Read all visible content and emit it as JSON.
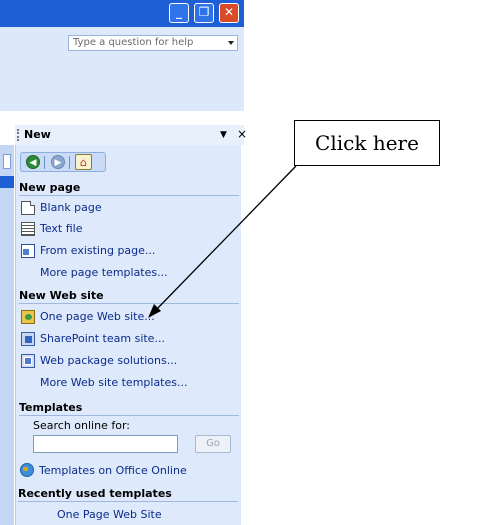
{
  "window": {
    "minimize_glyph": "_",
    "maximize_glyph": "❐",
    "close_glyph": "✕"
  },
  "help": {
    "placeholder": "Type a question for help"
  },
  "task_pane": {
    "title": "New",
    "dropdown_glyph": "▼",
    "close_glyph": "×",
    "nav": {
      "back_glyph": "◀",
      "forward_glyph": "▶",
      "home_glyph": "⌂"
    },
    "sections": {
      "new_page": {
        "heading": "New page",
        "items": [
          "Blank page",
          "Text file",
          "From existing page...",
          "More page templates..."
        ]
      },
      "new_web_site": {
        "heading": "New Web site",
        "items": [
          "One page Web site...",
          "SharePoint team site...",
          "Web package solutions...",
          "More Web site templates..."
        ]
      },
      "templates": {
        "heading": "Templates",
        "search_label": "Search online for:",
        "search_value": "",
        "go_label": "Go",
        "online_link": "Templates on Office Online"
      },
      "recent": {
        "heading": "Recently used templates",
        "items": [
          "One Page Web Site"
        ]
      }
    }
  },
  "callout": {
    "text": "Click here"
  },
  "icons": {
    "blank_page": "blank-page-icon",
    "text_file": "text-file-icon",
    "existing_page": "existing-page-icon",
    "one_page_site": "one-page-site-icon",
    "sharepoint": "sharepoint-icon",
    "web_package": "web-package-icon",
    "office_online": "office-online-globe-icon"
  },
  "colors": {
    "title_bar": "#1f5fd6",
    "pane_background": "#deeafb",
    "link": "#0b2b8a",
    "close_button": "#d94a26"
  }
}
